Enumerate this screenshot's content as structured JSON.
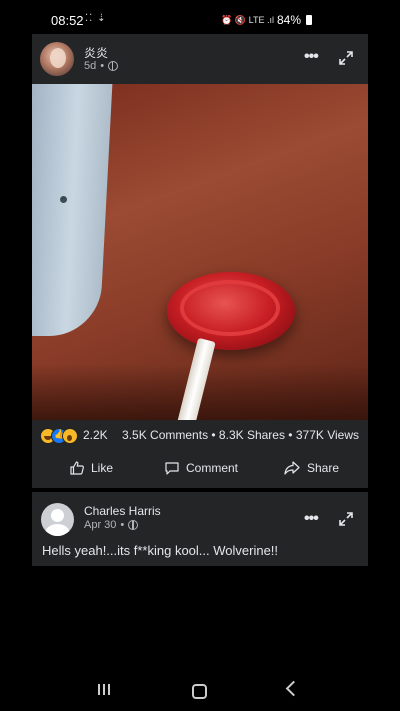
{
  "status_bar": {
    "time": "08:52",
    "notification_icons": "⁚⁚ ⇣",
    "system_icons": "⏰ 🔇 LTE .ıl",
    "battery": "84%"
  },
  "post": {
    "author": "炎炎",
    "age": "5d",
    "privacy_icon": "globe-icon",
    "reactions_count": "2.2K",
    "stats": "3.5K Comments • 8.3K Shares • 377K Views",
    "actions": {
      "like": "Like",
      "comment": "Comment",
      "share": "Share"
    }
  },
  "comment": {
    "author": "Charles Harris",
    "date": "Apr 30",
    "text": "Hells yeah!...its f**king kool... Wolverine!!"
  },
  "colors": {
    "card_bg": "#242526",
    "text": "#e4e6eb",
    "muted": "#b0b3b8"
  }
}
